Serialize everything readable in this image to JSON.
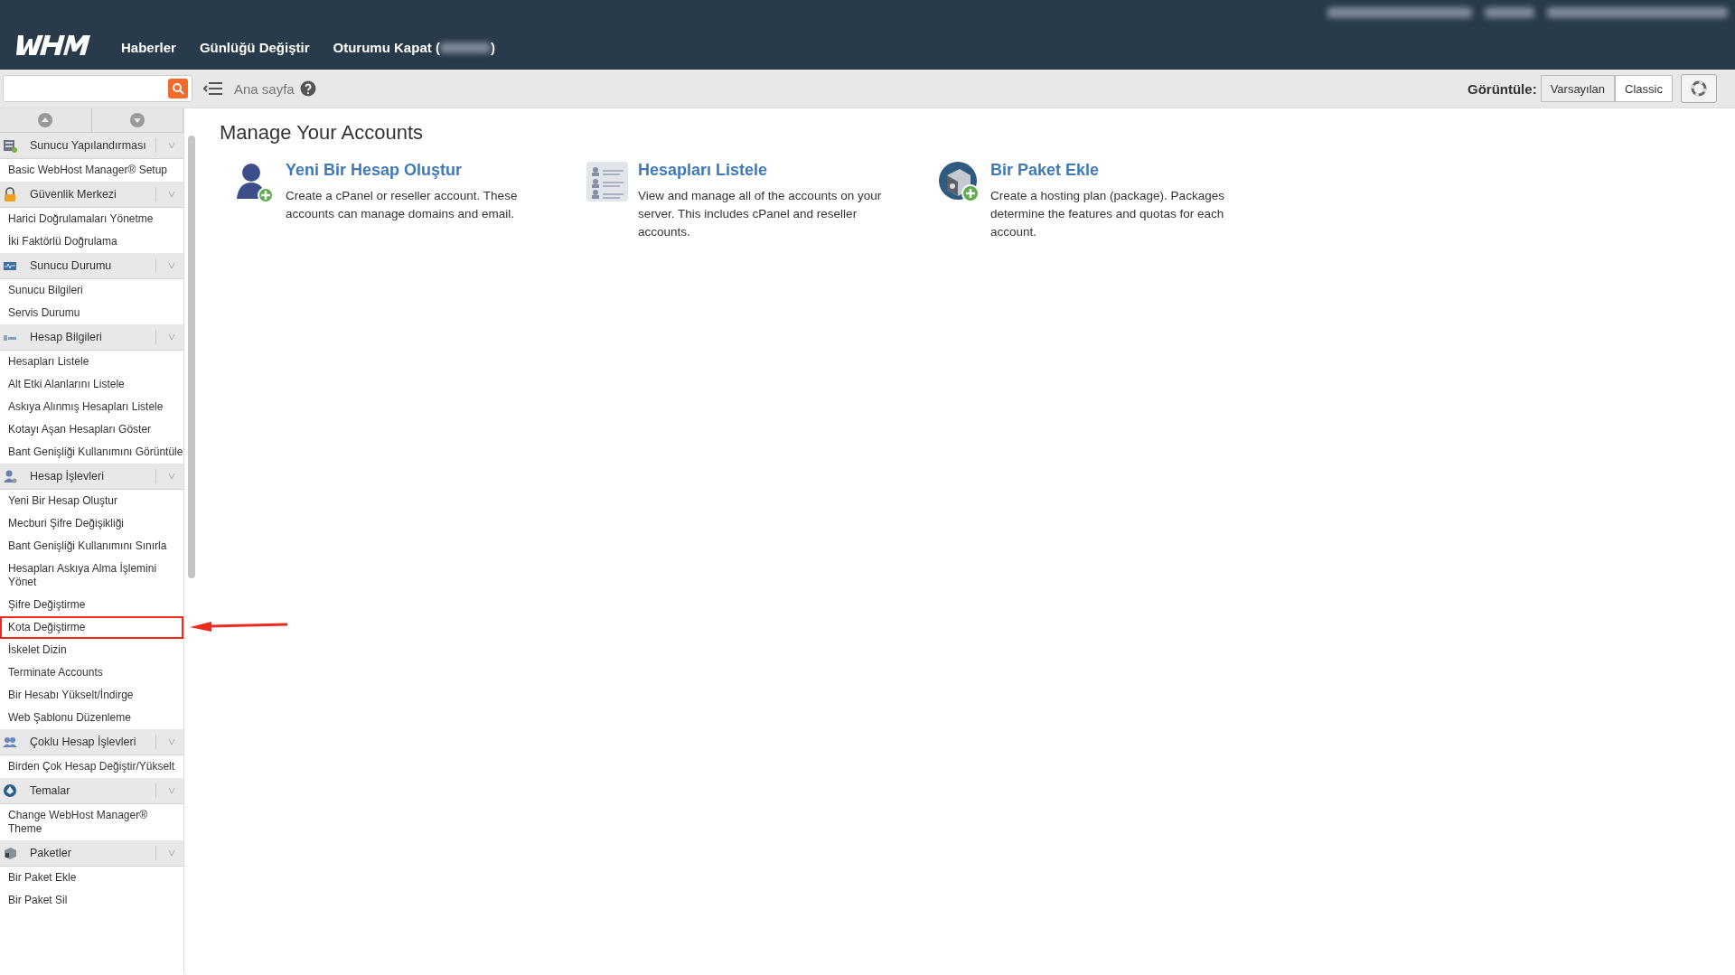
{
  "top_nav": {
    "links": [
      {
        "label": "Haberler"
      },
      {
        "label": "Günlüğü Değiştir"
      },
      {
        "label": "Oturumu Kapat (",
        "suffix": ")"
      }
    ]
  },
  "toolbar": {
    "breadcrumb": "Ana sayfa",
    "view_label": "Görüntüle:",
    "view_options": [
      {
        "label": "Varsayılan",
        "selected": true
      },
      {
        "label": "Classic",
        "selected": false
      }
    ]
  },
  "sidebar": {
    "groups": [
      {
        "title": "Sunucu Yapılandırması",
        "items": [
          {
            "label": "Basic WebHost Manager® Setup",
            "highlighted": false
          }
        ]
      },
      {
        "title": "Güvenlik Merkezi",
        "items": [
          {
            "label": "Harici Doğrulamaları Yönetme",
            "highlighted": false
          },
          {
            "label": "İki Faktörlü Doğrulama",
            "highlighted": false
          }
        ]
      },
      {
        "title": "Sunucu Durumu",
        "items": [
          {
            "label": "Sunucu Bilgileri",
            "highlighted": false
          },
          {
            "label": "Servis Durumu",
            "highlighted": false
          }
        ]
      },
      {
        "title": "Hesap Bilgileri",
        "items": [
          {
            "label": "Hesapları Listele",
            "highlighted": false
          },
          {
            "label": "Alt Etki Alanlarını Listele",
            "highlighted": false
          },
          {
            "label": "Askıya Alınmış Hesapları Listele",
            "highlighted": false
          },
          {
            "label": "Kotayı Aşan Hesapları Göster",
            "highlighted": false
          },
          {
            "label": "Bant Genişliği Kullanımını Görüntüle",
            "highlighted": false
          }
        ]
      },
      {
        "title": "Hesap İşlevleri",
        "items": [
          {
            "label": "Yeni Bir Hesap Oluştur",
            "highlighted": false
          },
          {
            "label": "Mecburi Şifre Değişikliği",
            "highlighted": false
          },
          {
            "label": "Bant Genişliği Kullanımını Sınırla",
            "highlighted": false
          },
          {
            "label": "Hesapları Askıya Alma İşlemini Yönet",
            "highlighted": false
          },
          {
            "label": "Şifre Değiştirme",
            "highlighted": false
          },
          {
            "label": "Kota Değiştirme",
            "highlighted": true
          },
          {
            "label": "İskelet Dizin",
            "highlighted": false
          },
          {
            "label": "Terminate Accounts",
            "highlighted": false
          },
          {
            "label": "Bir Hesabı Yükselt/İndirge",
            "highlighted": false
          },
          {
            "label": "Web Şablonu Düzenleme",
            "highlighted": false
          }
        ]
      },
      {
        "title": "Çoklu Hesap İşlevleri",
        "items": [
          {
            "label": "Birden Çok Hesap Değiştir/Yükselt",
            "highlighted": false
          }
        ]
      },
      {
        "title": "Temalar",
        "items": [
          {
            "label": "Change WebHost Manager® Theme",
            "highlighted": false
          }
        ]
      },
      {
        "title": "Paketler",
        "items": [
          {
            "label": "Bir Paket Ekle",
            "highlighted": false
          },
          {
            "label": "Bir Paket Sil",
            "highlighted": false
          }
        ]
      }
    ]
  },
  "content": {
    "title": "Manage Your Accounts",
    "cards": [
      {
        "title": "Yeni Bir Hesap Oluştur",
        "description": "Create a cPanel or reseller account. These accounts can manage domains and email."
      },
      {
        "title": "Hesapları Listele",
        "description": "View and manage all of the accounts on your server. This includes cPanel and reseller accounts."
      },
      {
        "title": "Bir Paket Ekle",
        "description": "Create a hosting plan (package). Packages determine the features and quotas for each account."
      }
    ]
  }
}
